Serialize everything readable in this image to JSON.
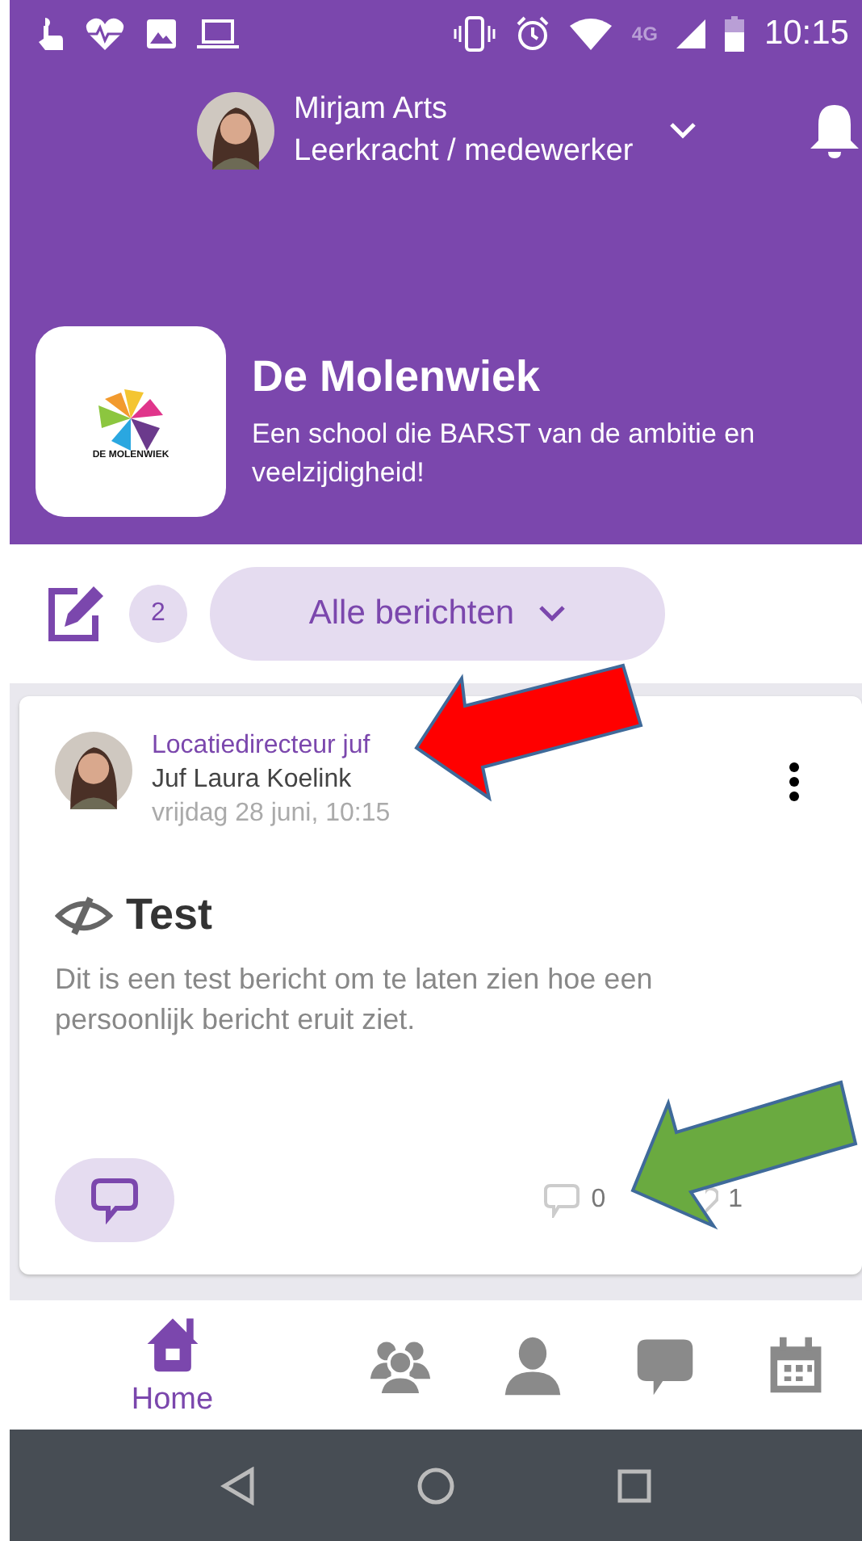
{
  "status_bar": {
    "network": "4G",
    "time": "10:15"
  },
  "header": {
    "user_name": "Mirjam Arts",
    "user_role": "Leerkracht / medewerker"
  },
  "school": {
    "logo_text": "DE MOLENWIEK",
    "name": "De Molenwiek",
    "tagline": "Een school die BARST van de ambitie en veelzijdigheid!"
  },
  "filter": {
    "draft_count": "2",
    "label": "Alle berichten"
  },
  "post": {
    "author_title": "Locatiedirecteur juf",
    "author_name": "Juf Laura Koelink",
    "date": "vrijdag 28 juni, 10:15",
    "title": "Test",
    "body": "Dit is een test bericht om te laten zien hoe een persoonlijk bericht eruit ziet.",
    "comment_count": "0",
    "like_count": "1"
  },
  "bottom_nav": [
    {
      "label": "Home",
      "selected": true
    },
    {
      "selected": false
    },
    {
      "selected": false
    },
    {
      "selected": false
    },
    {
      "selected": false
    }
  ]
}
